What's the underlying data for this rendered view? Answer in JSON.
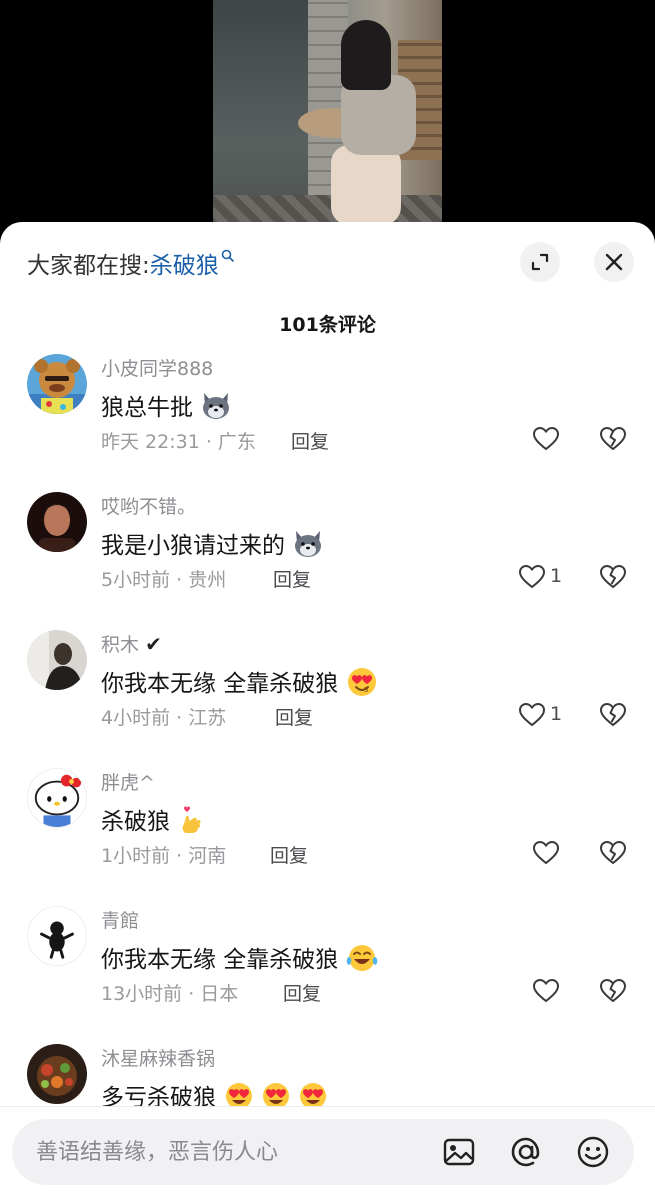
{
  "search": {
    "prefix": "大家都在搜:",
    "term": "杀破狼"
  },
  "header": {
    "comment_count": "101条评论"
  },
  "icons": {
    "expand": "expand-icon",
    "close": "close-icon",
    "like": "heart-icon",
    "dislike": "broken-heart-icon",
    "image": "image-icon",
    "mention": "at-icon",
    "emoji": "smiley-icon"
  },
  "colors": {
    "link": "#1b5fa8",
    "muted": "#8e8e93",
    "text": "#161616"
  },
  "comments": [
    {
      "user": "小皮同学888",
      "text": "狼总牛批",
      "emoji": "wolf",
      "meta": "昨天 22:31 · 广东",
      "reply": "回复",
      "likes": ""
    },
    {
      "user": "哎哟不错。",
      "text": "我是小狼请过来的",
      "emoji": "wolf",
      "meta": "5小时前 · 贵州",
      "reply": "回复",
      "likes": "1"
    },
    {
      "user": "积木",
      "verified": "✔",
      "text": "你我本无缘 全靠杀破狼",
      "emoji": "heart-eyes",
      "meta": "4小时前 · 江苏",
      "reply": "回复",
      "likes": "1"
    },
    {
      "user": "胖虎^",
      "text": "杀破狼",
      "emoji": "finger-heart",
      "meta": "1小时前 · 河南",
      "reply": "回复",
      "likes": ""
    },
    {
      "user": "青館",
      "text": "你我本无缘 全靠杀破狼",
      "emoji": "laugh-cry",
      "meta": "13小时前 · 日本",
      "reply": "回复",
      "likes": ""
    },
    {
      "user": "沐星麻辣香锅",
      "text": "多亏杀破狼",
      "emoji": "heart-eyes-x3",
      "meta": "",
      "reply": "",
      "likes": ""
    }
  ],
  "input": {
    "placeholder": "善语结善缘，恶言伤人心"
  }
}
